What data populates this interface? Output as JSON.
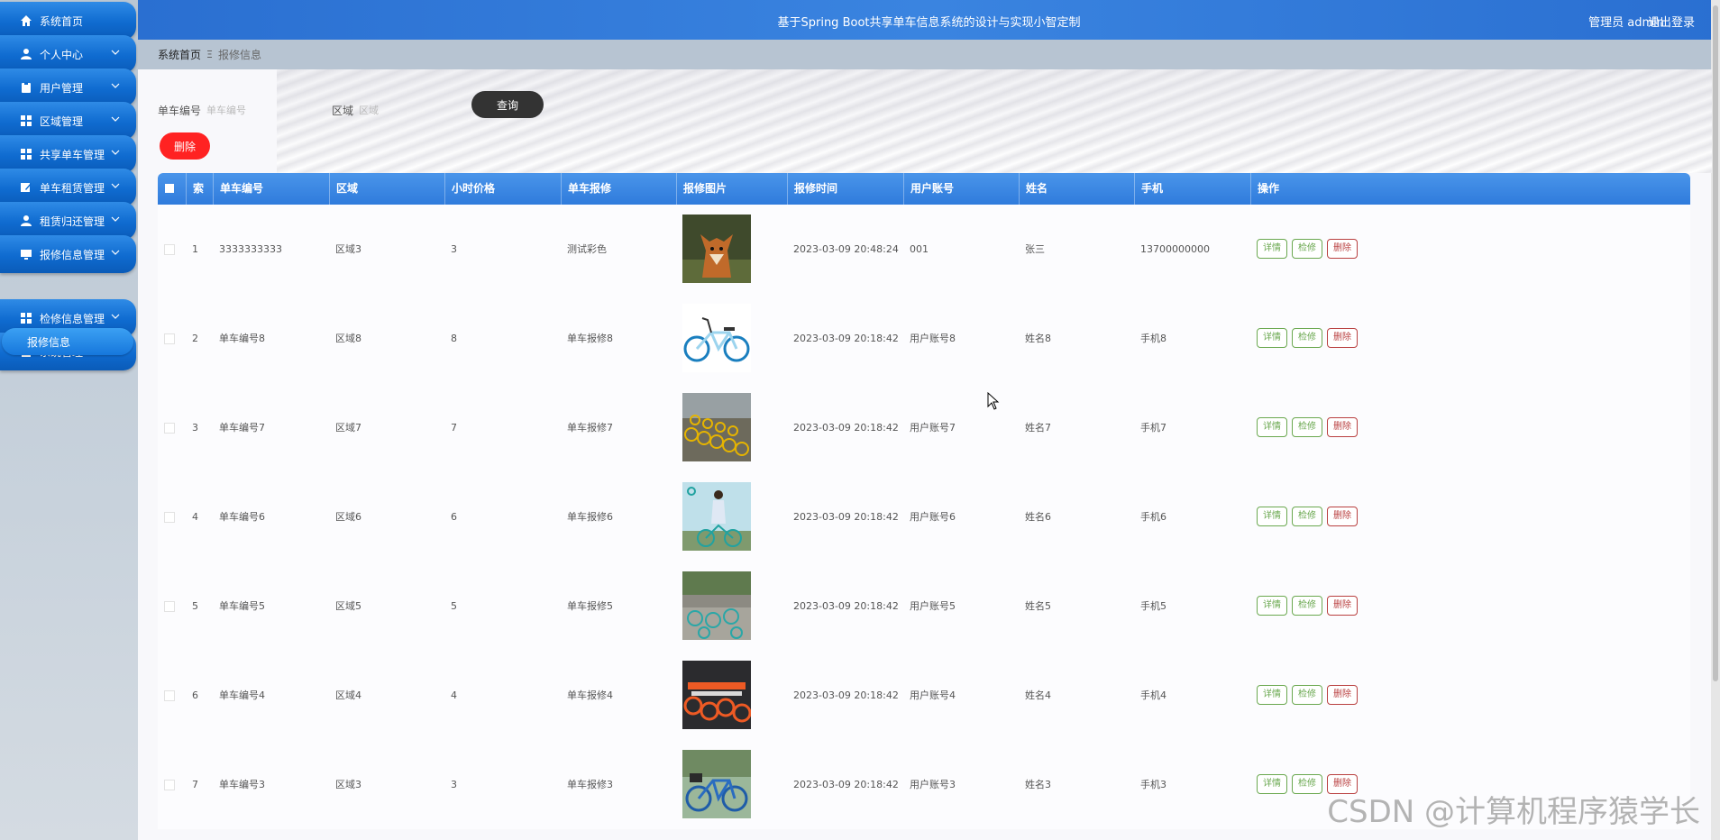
{
  "header": {
    "title": "基于Spring Boot共享单车信息系统的设计与实现小智定制",
    "user": "管理员 admin",
    "logout": "退出登录"
  },
  "sidebar": {
    "items": [
      {
        "label": "系统首页",
        "icon": "home-icon"
      },
      {
        "label": "个人中心",
        "icon": "user-icon"
      },
      {
        "label": "用户管理",
        "icon": "clipboard-icon"
      },
      {
        "label": "区域管理",
        "icon": "grid-icon"
      },
      {
        "label": "共享单车管理",
        "icon": "grid-icon"
      },
      {
        "label": "单车租赁管理",
        "icon": "edit-icon"
      },
      {
        "label": "租赁归还管理",
        "icon": "user-icon"
      },
      {
        "label": "报修信息管理",
        "icon": "monitor-icon"
      },
      {
        "label": "检修信息管理",
        "icon": "grid-icon"
      },
      {
        "label": "系统管理",
        "icon": "doc-icon"
      }
    ],
    "sub_item": "报修信息"
  },
  "breadcrumb": {
    "home": "系统首页",
    "separator": "Ξ",
    "current": "报修信息"
  },
  "search": {
    "field1_label": "单车编号",
    "field1_placeholder": "单车编号",
    "field2_label": "区域",
    "field2_placeholder": "区域",
    "query_button": "查询"
  },
  "delete_button": "删除",
  "table": {
    "headers": [
      "索引",
      "单车编号",
      "区域",
      "小时价格",
      "单车报修",
      "报修图片",
      "报修时间",
      "用户账号",
      "姓名",
      "手机",
      "操作"
    ],
    "action_labels": {
      "detail": "详情",
      "repair": "检修",
      "delete": "删除"
    },
    "rows": [
      {
        "index": "1",
        "bike_no": "3333333333",
        "area": "区域3",
        "price": "3",
        "repair": "测试彩色",
        "image": "fox",
        "time": "2023-03-09 20:48:24",
        "account": "001",
        "name": "张三",
        "phone": "13700000000"
      },
      {
        "index": "2",
        "bike_no": "单车编号8",
        "area": "区域8",
        "price": "8",
        "repair": "单车报修8",
        "image": "bike-white",
        "time": "2023-03-09 20:18:42",
        "account": "用户账号8",
        "name": "姓名8",
        "phone": "手机8"
      },
      {
        "index": "3",
        "bike_no": "单车编号7",
        "area": "区域7",
        "price": "7",
        "repair": "单车报修7",
        "image": "bike-rows",
        "time": "2023-03-09 20:18:42",
        "account": "用户账号7",
        "name": "姓名7",
        "phone": "手机7"
      },
      {
        "index": "4",
        "bike_no": "单车编号6",
        "area": "区域6",
        "price": "6",
        "repair": "单车报修6",
        "image": "woman-bike",
        "time": "2023-03-09 20:18:42",
        "account": "用户账号6",
        "name": "姓名6",
        "phone": "手机6"
      },
      {
        "index": "5",
        "bike_no": "单车编号5",
        "area": "区域5",
        "price": "5",
        "repair": "单车报修5",
        "image": "street-bikes",
        "time": "2023-03-09 20:18:42",
        "account": "用户账号5",
        "name": "姓名5",
        "phone": "手机5"
      },
      {
        "index": "6",
        "bike_no": "单车编号4",
        "area": "区域4",
        "price": "4",
        "repair": "单车报修4",
        "image": "orange-bikes",
        "time": "2023-03-09 20:18:42",
        "account": "用户账号4",
        "name": "姓名4",
        "phone": "手机4"
      },
      {
        "index": "7",
        "bike_no": "单车编号3",
        "area": "区域3",
        "price": "3",
        "repair": "单车报修3",
        "image": "blue-bike",
        "time": "2023-03-09 20:18:42",
        "account": "用户账号3",
        "name": "姓名3",
        "phone": "手机3"
      }
    ]
  },
  "watermark": "CSDN @计算机程序猿学长",
  "colors": {
    "header": "#2a6fd1",
    "table_header": "#3f8ae6",
    "menu": "#0f6bd0",
    "danger": "#ff2222",
    "query": "#333333"
  }
}
